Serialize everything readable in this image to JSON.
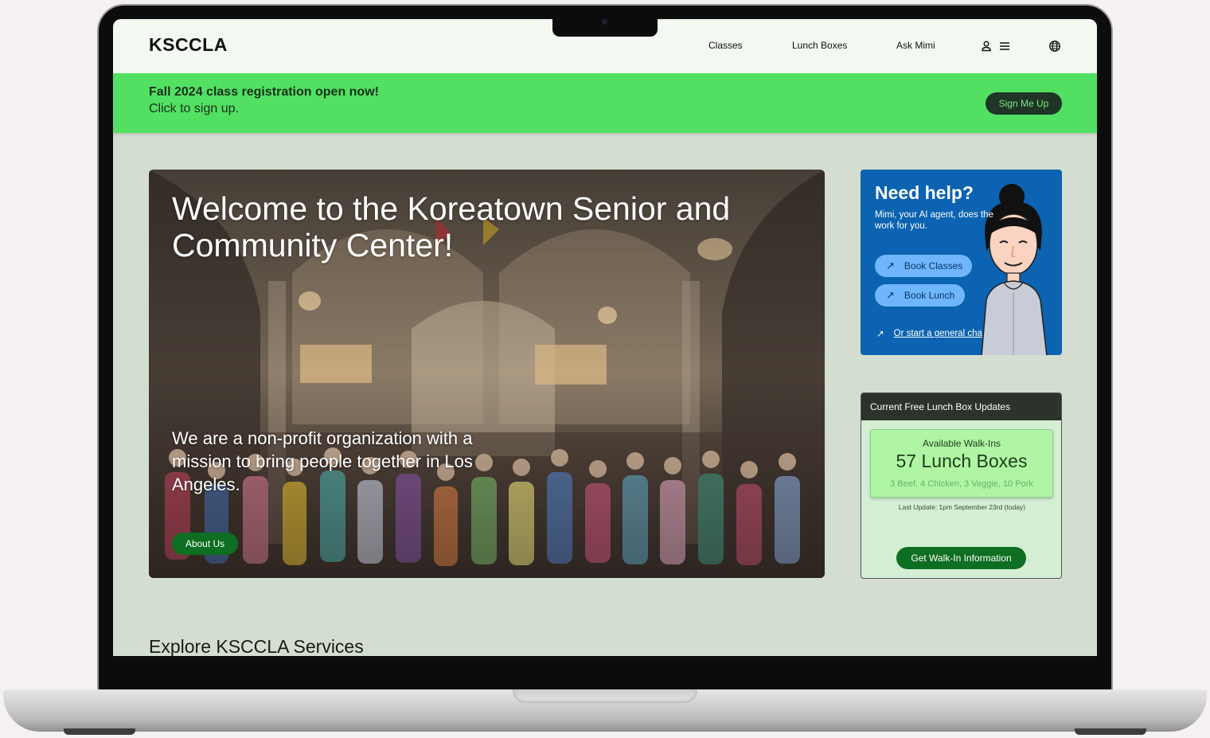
{
  "nav": {
    "logo": "KSCCLA",
    "links": [
      "Classes",
      "Lunch Boxes",
      "Ask Mimi"
    ],
    "icons": [
      "user-icon",
      "menu-icon",
      "globe-icon"
    ]
  },
  "banner": {
    "title": "Fall 2024 class registration open now!",
    "subtitle": "Click to sign up.",
    "button": "Sign Me Up"
  },
  "hero": {
    "title": "Welcome to the Koreatown Senior and Community Center!",
    "description": "We are a non-profit organization with a mission to bring people together in Los Angeles.",
    "button": "About Us"
  },
  "help": {
    "title": "Need help?",
    "subtitle": "Mimi, your AI agent, does the work for you.",
    "buttons": [
      "Book Classes",
      "Book Lunch"
    ],
    "chat_link": "Or start a general cha"
  },
  "lunch": {
    "header": "Current Free Lunch Box Updates",
    "label": "Available Walk-Ins",
    "count": "57 Lunch Boxes",
    "detail": "3 Beef, 4 Chicken, 3 Veggie, 10 Pork",
    "last_update": "Last Update: 1pm September 23rd (today)",
    "button": "Get Walk-In Information"
  },
  "explore_title": "Explore KSCCLA Services",
  "colors": {
    "page_bg": "#d3ddd0",
    "banner": "#52e063",
    "primary_button": "#0e6e21",
    "help_card": "#0b63b1",
    "lunch_card": "#d3eed3"
  }
}
